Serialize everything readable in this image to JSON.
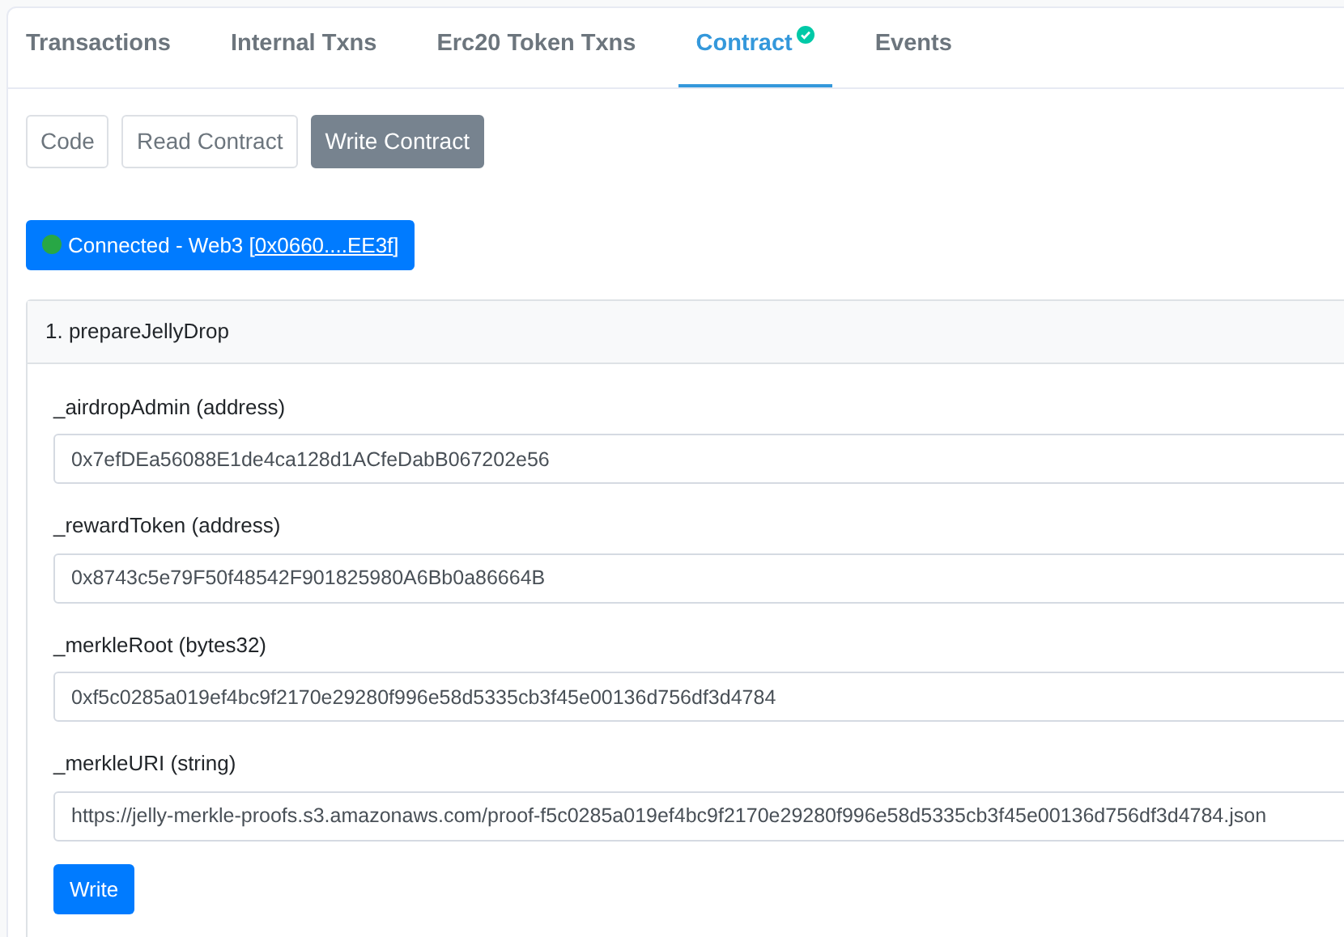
{
  "tabs": [
    {
      "label": "Transactions",
      "selected": false,
      "verified": false
    },
    {
      "label": "Internal Txns",
      "selected": false,
      "verified": false
    },
    {
      "label": "Erc20 Token Txns",
      "selected": false,
      "verified": false
    },
    {
      "label": "Contract",
      "selected": true,
      "verified": true
    },
    {
      "label": "Events",
      "selected": false,
      "verified": false
    }
  ],
  "subtabs": [
    {
      "label": "Code",
      "selected": false
    },
    {
      "label": "Read Contract",
      "selected": false
    },
    {
      "label": "Write Contract",
      "selected": true
    }
  ],
  "connection": {
    "connected": true,
    "label": "Connected - Web3 [",
    "address": "0x0660....EE3f",
    "suffix": "]"
  },
  "method": {
    "title": "1. prepareJellyDrop",
    "params": [
      {
        "label": "_airdropAdmin (address)",
        "value": "0x7efDEa56088E1de4ca128d1ACfeDabB067202e56"
      },
      {
        "label": "_rewardToken (address)",
        "value": "0x8743c5e79F50f48542F901825980A6Bb0a86664B"
      },
      {
        "label": "_merkleRoot (bytes32)",
        "value": "0xf5c0285a019ef4bc9f2170e29280f996e58d5335cb3f45e00136d756df3d4784"
      },
      {
        "label": "_merkleURI (string)",
        "value": "https://jelly-merkle-proofs.s3.amazonaws.com/proof-f5c0285a019ef4bc9f2170e29280f996e58d5335cb3f45e00136d756df3d4784.json"
      }
    ],
    "button": "Write"
  }
}
